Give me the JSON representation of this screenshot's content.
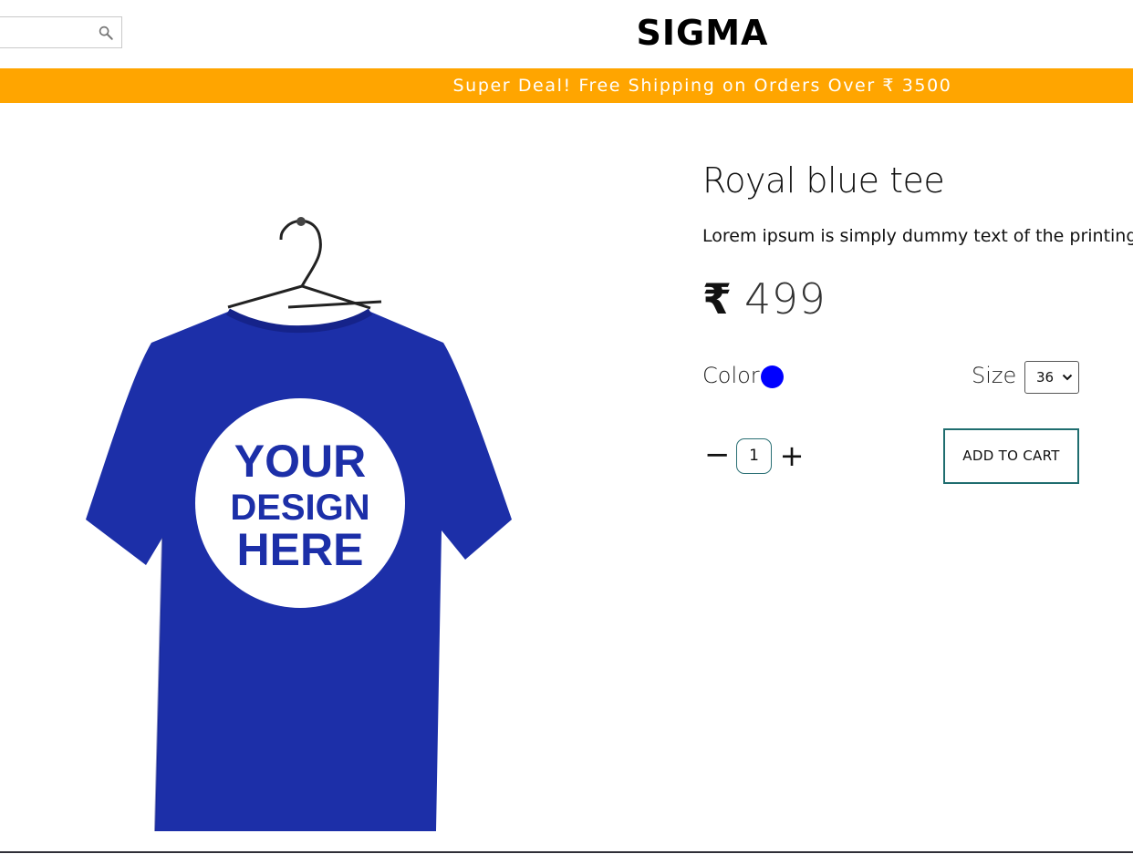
{
  "header": {
    "brand": "SIGMA",
    "search": {
      "placeholder": "",
      "value": "",
      "icon": "search-icon"
    }
  },
  "promo": {
    "text": "Super Deal! Free Shipping on Orders Over ₹ 3500",
    "background": "#FFA500",
    "text_color": "#FFFFFF"
  },
  "product": {
    "image": {
      "alt": "Royal blue tee",
      "printed_text": "YOUR DESIGN HERE",
      "shirt_color": "#1C2FA8"
    },
    "title": "Royal blue tee",
    "description": "Lorem ipsum is simply dummy text of the printing and",
    "price": {
      "currency": "₹",
      "amount": "499"
    },
    "color": {
      "label": "Color",
      "swatch": "#0000FF"
    },
    "size": {
      "label": "Size",
      "selected": "36"
    },
    "quantity": {
      "minus": "−",
      "value": "1",
      "plus": "+"
    },
    "add_to_cart": "ADD TO CART",
    "accent": "#1F6D6F"
  }
}
